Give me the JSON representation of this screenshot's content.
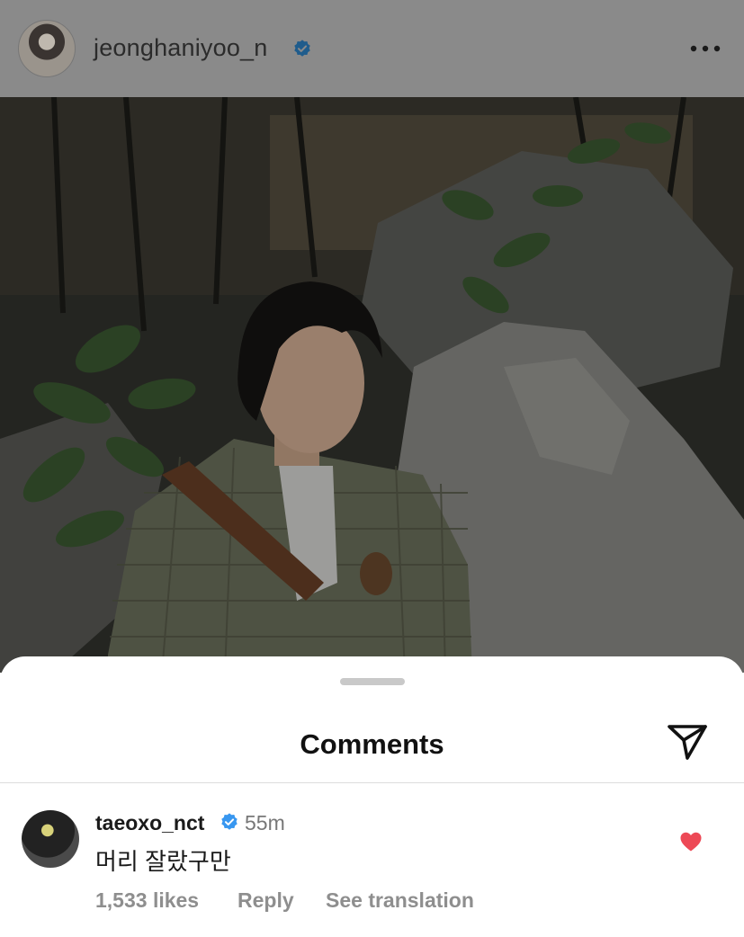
{
  "post_header": {
    "username": "jeonghaniyoo_n",
    "verified": true,
    "more_icon": "more-horizontal-icon"
  },
  "comments_sheet": {
    "title": "Comments",
    "share_icon": "send-icon"
  },
  "comments": [
    {
      "username": "taeoxo_nct",
      "verified": true,
      "time": "55m",
      "text": "머리 잘랐구만",
      "likes": "1,533 likes",
      "reply_label": "Reply",
      "translation_label": "See translation",
      "liked": true
    }
  ],
  "colors": {
    "verified_blue": "#3897f0",
    "heart_red": "#ed4956",
    "meta_gray": "#8e8e8e"
  }
}
